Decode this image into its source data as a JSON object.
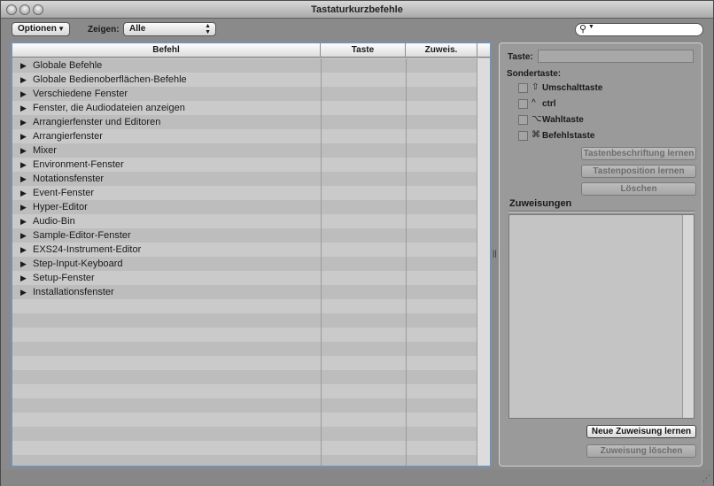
{
  "window": {
    "title": "Tastaturkurzbefehle"
  },
  "toolbar": {
    "options_label": "Optionen",
    "zeigen_label": "Zeigen:",
    "zeigen_value": "Alle"
  },
  "table": {
    "headers": {
      "befehl": "Befehl",
      "taste": "Taste",
      "zuweis": "Zuweis."
    },
    "rows": [
      "Globale Befehle",
      "Globale Bedienoberflächen-Befehle",
      "Verschiedene Fenster",
      "Fenster, die Audiodateien anzeigen",
      "Arrangierfenster und Editoren",
      "Arrangierfenster",
      "Mixer",
      "Environment-Fenster",
      "Notationsfenster",
      "Event-Fenster",
      "Hyper-Editor",
      "Audio-Bin",
      "Sample-Editor-Fenster",
      "EXS24-Instrument-Editor",
      "Step-Input-Keyboard",
      "Setup-Fenster",
      "Installationsfenster"
    ]
  },
  "panel": {
    "taste_label": "Taste:",
    "sondertaste_label": "Sondertaste:",
    "modifiers": [
      {
        "glyph": "⇧",
        "label": "Umschalttaste",
        "icon": "shift-icon"
      },
      {
        "glyph": "^",
        "label": "ctrl",
        "icon": "control-icon"
      },
      {
        "glyph": "⌥",
        "label": "Wahltaste",
        "icon": "option-icon"
      },
      {
        "glyph": "⌘",
        "label": "Befehlstaste",
        "icon": "command-icon"
      }
    ],
    "btn_tastenbeschriftung": "Tastenbeschriftung lernen",
    "btn_tastenposition": "Tastenposition lernen",
    "btn_loeschen": "Löschen",
    "zuweisungen_title": "Zuweisungen",
    "btn_neue_zuweisung": "Neue Zuweisung lernen",
    "btn_zuweisung_loeschen": "Zuweisung löschen"
  },
  "colors": {
    "selection_border": "#7392b4",
    "window_bg": "#8a8a8a"
  }
}
